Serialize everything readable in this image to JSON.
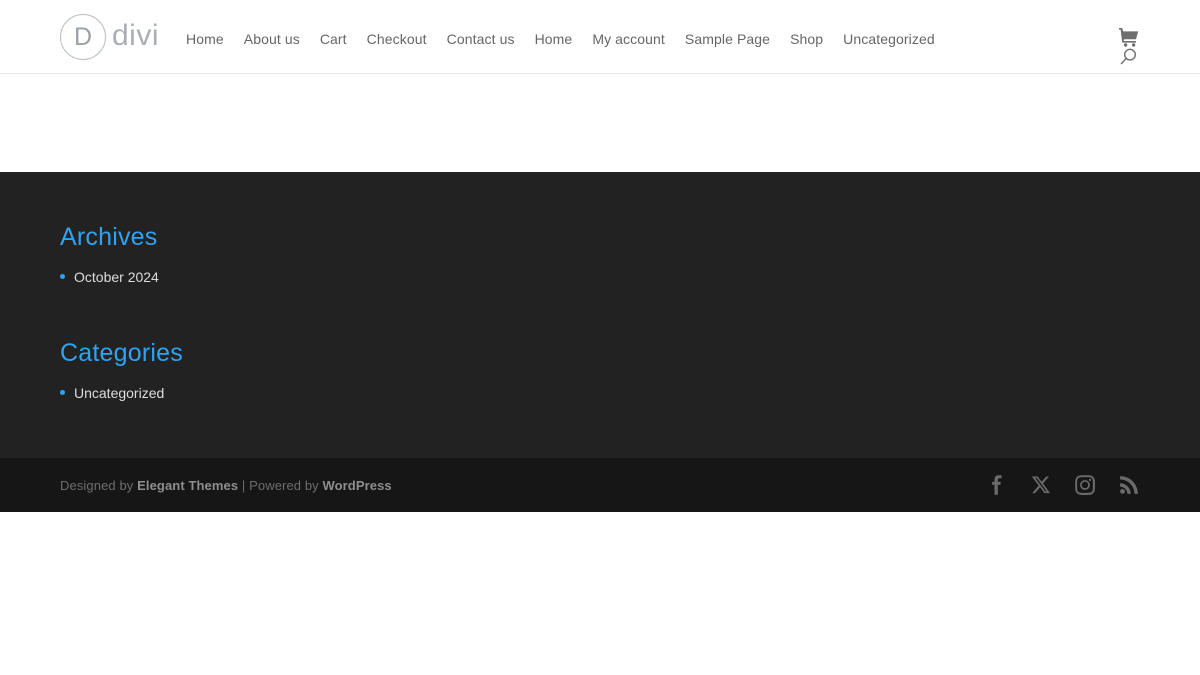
{
  "header": {
    "logo": {
      "mark_letter": "D",
      "text": "divi",
      "icon_name": "divi-logo-circle-icon"
    },
    "nav_items": [
      {
        "label": "Home"
      },
      {
        "label": "About us"
      },
      {
        "label": "Cart"
      },
      {
        "label": "Checkout"
      },
      {
        "label": "Contact us"
      },
      {
        "label": "Home"
      },
      {
        "label": "My account"
      },
      {
        "label": "Sample Page"
      },
      {
        "label": "Shop"
      },
      {
        "label": "Uncategorized"
      }
    ],
    "cart_icon": "shopping-cart-icon",
    "search_icon": "search-icon"
  },
  "footer": {
    "widgets": [
      {
        "title": "Archives",
        "items": [
          {
            "label": "October 2024"
          }
        ]
      },
      {
        "title": "Categories",
        "items": [
          {
            "label": "Uncategorized"
          }
        ]
      }
    ],
    "bottom": {
      "credits_prefix": "Designed by ",
      "credits_brand": "Elegant Themes",
      "credits_middle": " | Powered by ",
      "credits_platform": "WordPress",
      "social": [
        {
          "name": "facebook-icon",
          "label": "Facebook"
        },
        {
          "name": "x-twitter-icon",
          "label": "X"
        },
        {
          "name": "instagram-icon",
          "label": "Instagram"
        },
        {
          "name": "rss-icon",
          "label": "RSS"
        }
      ]
    }
  },
  "colors": {
    "accent": "#2ea3f2",
    "footer_bg": "#222222",
    "footer_bottom_bg": "#161616",
    "nav_text": "#666666"
  }
}
